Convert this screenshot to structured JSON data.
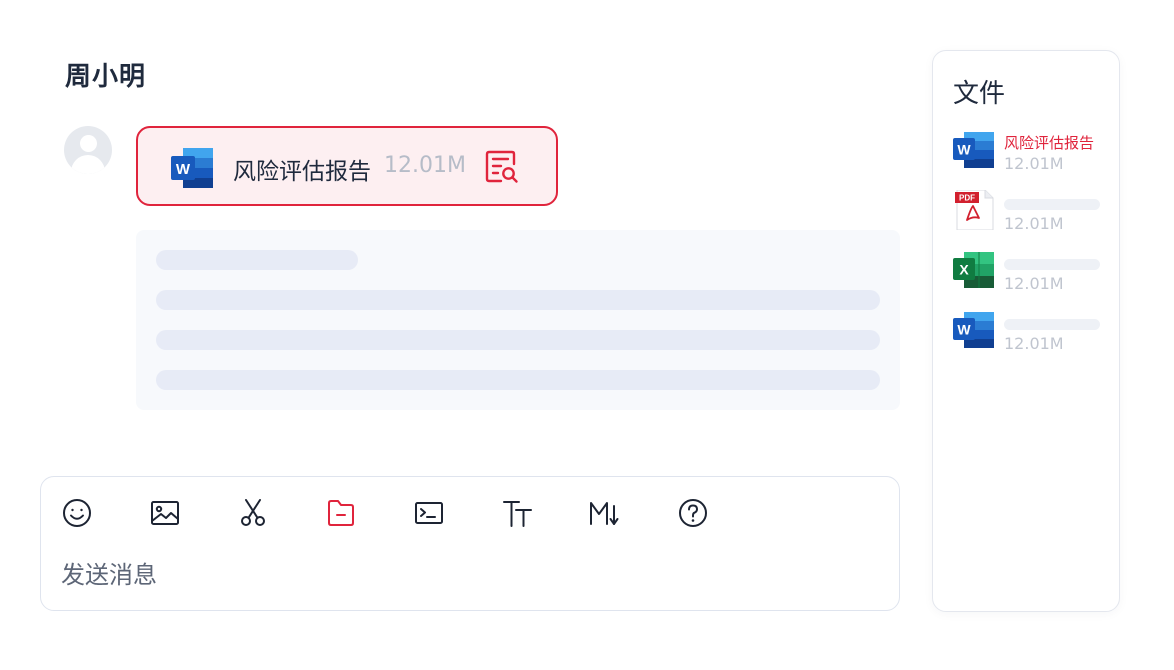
{
  "chat": {
    "contact_name": "周小明"
  },
  "message": {
    "file": {
      "name": "风险评估报告",
      "size": "12.01M",
      "type_icon": "word-icon",
      "action_icon": "file-preview-icon"
    }
  },
  "composer": {
    "placeholder": "发送消息",
    "tools": [
      {
        "name": "emoji-icon"
      },
      {
        "name": "image-icon"
      },
      {
        "name": "scissors-icon"
      },
      {
        "name": "folder-icon"
      },
      {
        "name": "terminal-icon"
      },
      {
        "name": "text-size-icon"
      },
      {
        "name": "markdown-icon"
      },
      {
        "name": "help-icon"
      }
    ]
  },
  "files_panel": {
    "title": "文件",
    "items": [
      {
        "type": "word-icon",
        "name": "风险评估报告",
        "size": "12.01M"
      },
      {
        "type": "pdf-icon",
        "name": "",
        "size": "12.01M"
      },
      {
        "type": "excel-icon",
        "name": "",
        "size": "12.01M"
      },
      {
        "type": "word-icon",
        "name": "",
        "size": "12.01M"
      }
    ]
  },
  "colors": {
    "accent": "#e0243c",
    "word_blue": "#185abd",
    "excel_green": "#107c41",
    "pdf_red": "#d2202e"
  }
}
